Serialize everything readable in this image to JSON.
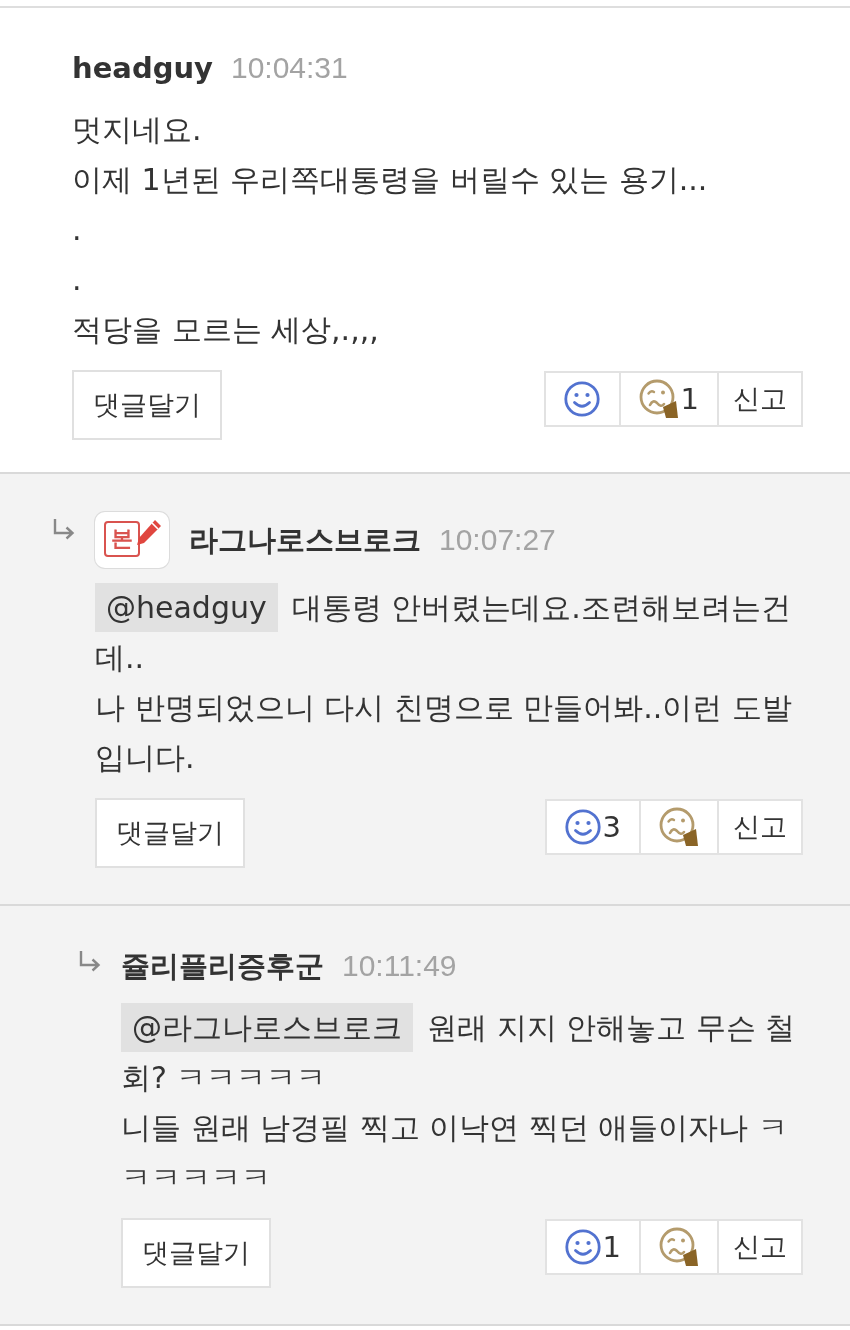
{
  "comments": [
    {
      "author": "headguy",
      "time": "10:04:31",
      "body": [
        "멋지네요.",
        "이제 1년된 우리쪽대통령을 버릴수 있는 용기...",
        ".",
        ".",
        "적당을 모르는 세상,.,,,"
      ],
      "reply_button": "댓글달기",
      "reactions": [
        {
          "kind": "like"
        },
        {
          "kind": "dislike",
          "count": "1"
        }
      ],
      "report_button": "신고",
      "children": [
        {
          "author": "라그나로스브로크",
          "badge": "본",
          "time": "10:07:27",
          "mention": "@headguy",
          "body": [
            "대통령 안버렸는데요.조련해보려는건데..",
            "나 반명되었으니 다시 친명으로 만들어봐..이런 도발입니다."
          ],
          "reply_button": "댓글달기",
          "reactions": [
            {
              "kind": "like",
              "count": "3"
            },
            {
              "kind": "dislike"
            }
          ],
          "report_button": "신고",
          "children": [
            {
              "author": "쥴리플리증후군",
              "time": "10:11:49",
              "mention": "@라그나로스브로크",
              "body": [
                "원래 지지 안해놓고 무슨 철회? ㅋㅋㅋㅋㅋ",
                "니들 원래 남경필 찍고 이낙연 찍던 애들이자나 ㅋㅋㅋㅋㅋㅋ"
              ],
              "reply_button": "댓글달기",
              "reactions": [
                {
                  "kind": "like",
                  "count": "1"
                },
                {
                  "kind": "dislike"
                }
              ],
              "report_button": "신고"
            }
          ]
        }
      ]
    }
  ]
}
